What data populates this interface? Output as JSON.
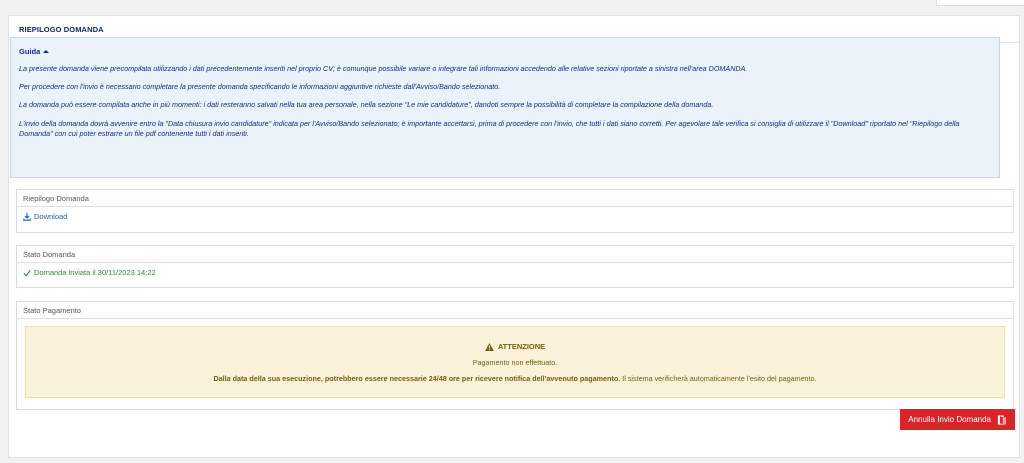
{
  "header": {
    "title": "RIEPILOGO DOMANDA"
  },
  "guide": {
    "title": "Guida",
    "paragraphs": [
      "La presente domanda viene precompilata utilizzando i dati precedentemente inseriti nel proprio CV; è comunque possibile variare o integrare tali informazioni accedendo alle relative sezioni riportate a sinistra nell'area DOMANDA.",
      "Per procedere con l'invio è necessario completare la presente domanda specificando le informazioni aggiuntive richieste dall'Avviso/Bando selezionato.",
      "La domanda può essere compilata anche in più momenti: i dati resteranno salvati nella tua area personale, nella sezione \"Le mie candidature\", dandoti sempre la possibilità di completare la compilazione della domanda.",
      "L'invio della domanda dovrà avvenire entro la \"Data chiusura invio candidature\" indicata per l'Avviso/Bando selezionato; è importante accertarsi, prima di procedere con l'invio, che tutti i dati siano corretti. Per agevolare tale verifica si consiglia di utilizzare il \"Download\" riportato nel \"Riepilogo della Domanda\" con cui poter estrarre un file pdf contenente tutti i dati inseriti."
    ]
  },
  "riepilogo": {
    "title": "Riepilogo Domanda",
    "download_label": "Download"
  },
  "stato": {
    "title": "Stato Domanda",
    "status_text": "Domanda inviata il 30/11/2023 14:22"
  },
  "pagamento": {
    "title": "Stato Pagamento",
    "alert_title": "ATTENZIONE",
    "alert_line1": "Pagamento non effettuato.",
    "alert_line2_bold": "Dalla data della sua esecuzione, potrebbero essere necessarie 24/48 ore per ricevere notifica dell'avvenuto pagamento.",
    "alert_line2_rest": " Il sistema verificherà automaticamente l'esito del pagamento."
  },
  "actions": {
    "cancel_label": "Annulla Invio Domanda"
  },
  "colors": {
    "accent": "#d9242a",
    "guide_text": "#0b2e8a",
    "success": "#2e8b2e",
    "warning_bg": "#fbf3d9"
  },
  "icons": {
    "guide_toggle": "caret-up-icon",
    "download": "download-icon",
    "status": "check-icon",
    "alert": "warning-icon",
    "cancel": "door-exit-icon"
  }
}
